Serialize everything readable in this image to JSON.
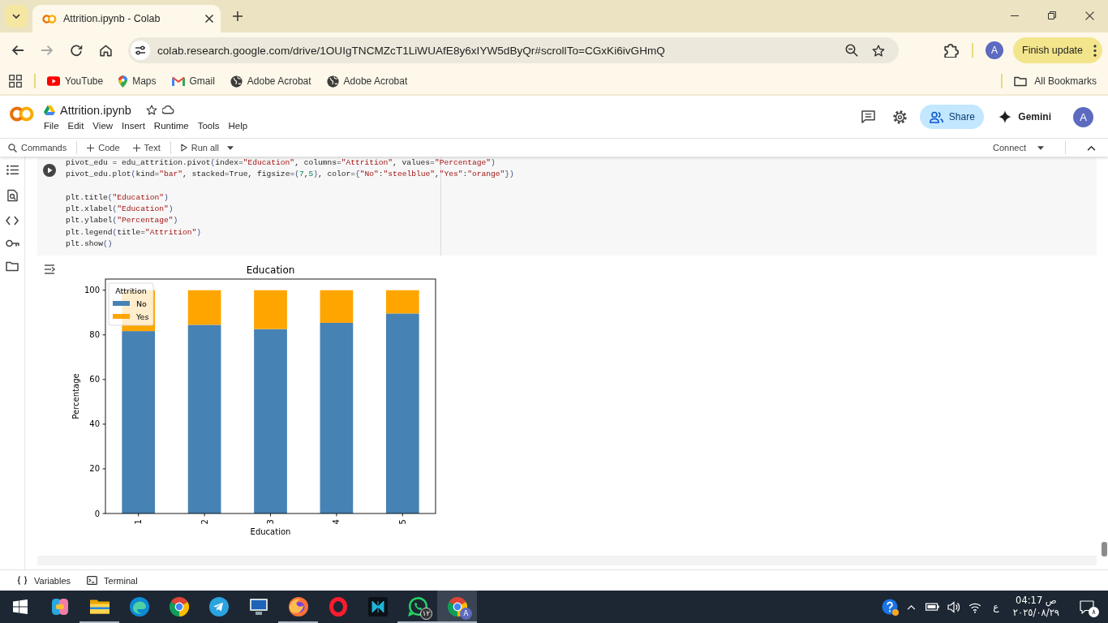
{
  "browser": {
    "tabs": [
      {
        "title": "Attrition.ipynb - Colab",
        "selected": true
      }
    ],
    "back_disabled": false,
    "forward_disabled": true,
    "address": "colab.research.google.com/drive/1OUIgTNCMZcT1LiWUAfE8y6xIYW5dByQr#scrollTo=CGxKi6ivGHmQ",
    "profile": "A",
    "update_button": "Finish update",
    "bookmarks": [
      {
        "kind": "youtube",
        "label": "YouTube"
      },
      {
        "kind": "maps",
        "label": "Maps"
      },
      {
        "kind": "gmail",
        "label": "Gmail"
      },
      {
        "kind": "globe",
        "label": "Adobe Acrobat"
      },
      {
        "kind": "globe",
        "label": "Adobe Acrobat"
      }
    ],
    "all_bookmarks": "All Bookmarks"
  },
  "notebook": {
    "title": "Attrition.ipynb",
    "menu": [
      "File",
      "Edit",
      "View",
      "Insert",
      "Runtime",
      "Tools",
      "Help"
    ],
    "share_button": "Share",
    "gemini_button": "Gemini",
    "avatar": "A",
    "toolbar": {
      "commands": "Commands",
      "add_code": "Code",
      "add_text": "Text",
      "run_all": "Run all",
      "connect": "Connect"
    },
    "cell": {
      "code_blocks": [
        [
          "pivot_edu = edu_attrition.pivot(index=\"Education\", columns=\"Attrition\", values=\"Percentage\")",
          "pivot_edu.plot(kind=\"bar\", stacked=True, figsize=(7,5), color={\"No\":\"steelblue\",\"Yes\":\"orange\"})"
        ],
        [
          "plt.title(\"Education\")",
          "plt.xlabel(\"Education\")",
          "plt.ylabel(\"Percentage\")",
          "plt.legend(title=\"Attrition\")",
          "plt.show()"
        ]
      ]
    },
    "output": {
      "chart_data": [
        {
          "type": "bar",
          "title": "Education",
          "xlabel": "Education",
          "ylabel": "Percentage",
          "legend_title": "Attrition",
          "legend": "upper left",
          "categories": [
            "1",
            "2",
            "3",
            "4",
            "5"
          ],
          "stacked": true,
          "series": [
            {
              "name": "No",
              "color": "#4682b4",
              "values": [
                81.7,
                84.5,
                82.6,
                85.4,
                89.6
              ]
            },
            {
              "name": "Yes",
              "color": "#ffa500",
              "values": [
                18.3,
                15.5,
                17.4,
                14.6,
                10.4
              ]
            }
          ],
          "ylim": [
            0,
            105
          ],
          "yticks": [
            0,
            20,
            40,
            60,
            80,
            100
          ]
        }
      ]
    },
    "bottom_bar": [
      {
        "kind": "variables",
        "label": "Variables"
      },
      {
        "kind": "terminal",
        "label": "Terminal"
      }
    ]
  },
  "taskbar": {
    "apps": [
      {
        "kind": "copilot",
        "running": false,
        "selected": false
      },
      {
        "kind": "explorer",
        "running": true,
        "selected": false
      },
      {
        "kind": "edge",
        "running": false,
        "selected": false
      },
      {
        "kind": "chrome",
        "running": false,
        "selected": false
      },
      {
        "kind": "telegram",
        "running": false,
        "selected": false
      },
      {
        "kind": "monitor",
        "running": false,
        "selected": false
      },
      {
        "kind": "firefox",
        "running": true,
        "selected": false
      },
      {
        "kind": "opera",
        "running": false,
        "selected": false
      },
      {
        "kind": "tile",
        "running": false,
        "selected": false
      },
      {
        "kind": "whatsapp",
        "running": true,
        "selected": false,
        "badge": "١٢"
      },
      {
        "kind": "chrome",
        "running": true,
        "selected": true,
        "badge": "A"
      }
    ],
    "tray": {
      "language": "ع",
      "time": "04:17 ص",
      "date": "٢٠٢٥/٠٨/٢٩",
      "notifications": "٨"
    }
  }
}
